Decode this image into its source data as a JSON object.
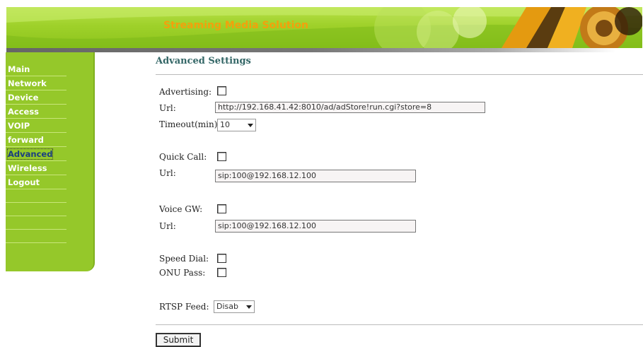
{
  "header": {
    "title": "Streaming Media Solution"
  },
  "sidebar": {
    "items": [
      {
        "label": "Main"
      },
      {
        "label": "Network"
      },
      {
        "label": "Device"
      },
      {
        "label": "Access"
      },
      {
        "label": "VOIP"
      },
      {
        "label": "forward"
      },
      {
        "label": "Advanced"
      },
      {
        "label": "Wireless"
      },
      {
        "label": "Logout"
      }
    ],
    "active": "Advanced"
  },
  "page": {
    "title": "Advanced Settings"
  },
  "form": {
    "advertising": {
      "label": "Advertising:",
      "checked": false
    },
    "ad_url": {
      "label": "Url:",
      "value": "http://192.168.41.42:8010/ad/adStore!run.cgi?store=8"
    },
    "timeout": {
      "label": "Timeout(min):",
      "value": "10"
    },
    "quick_call": {
      "label": "Quick Call:",
      "checked": false
    },
    "quick_call_url": {
      "label": "Url:",
      "value": "sip:100@192.168.12.100"
    },
    "voice_gw": {
      "label": "Voice GW:",
      "checked": false
    },
    "voice_gw_url": {
      "label": "Url:",
      "value": "sip:100@192.168.12.100"
    },
    "speed_dial": {
      "label": "Speed Dial:",
      "checked": false
    },
    "onu_pass": {
      "label": "ONU Pass:",
      "checked": false
    },
    "rtsp_feed": {
      "label": "RTSP Feed:",
      "value": "Disab"
    },
    "submit_label": "Submit"
  },
  "colors": {
    "banner_green": "#9fd12a",
    "sidebar_green": "#95c82a",
    "title_orange": "#f3a00c",
    "heading_teal": "#336666"
  }
}
